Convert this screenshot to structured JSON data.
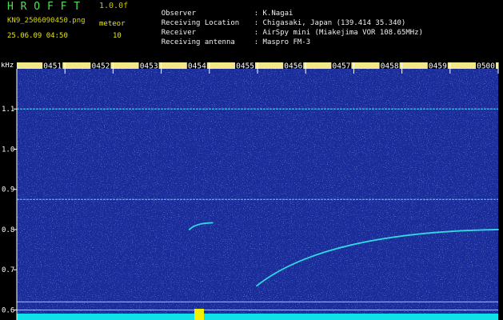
{
  "header": {
    "app_name": "H R O F F T",
    "app_version": "1.0.0f",
    "file_name": "KN9_2506090450.png",
    "mode_label": "meteor",
    "timestamp": "25.06.09 04:50",
    "mode_value": "10",
    "info": [
      {
        "label": "Observer",
        "value": ": K.Nagai"
      },
      {
        "label": "Receiving Location",
        "value": ": Chigasaki, Japan (139.414 35.340)"
      },
      {
        "label": "Receiver",
        "value": ": AirSpy mini (Miakejima VOR 108.65MHz)"
      },
      {
        "label": "Receiving antenna",
        "value": ": Maspro FM-3"
      }
    ]
  },
  "colors": {
    "background": "#000000",
    "noise": "#1a2c9a",
    "signal": "#30d8e0",
    "axis": "#ffffff",
    "time_label_bg": "#f2e88a",
    "app_name": "#4ee24e",
    "label_yellow": "#e8e800"
  },
  "plot": {
    "freq_unit": "kHz",
    "freq_ticks": [
      "1.1",
      "1.0",
      "0.9",
      "0.8",
      "0.7",
      "0.6"
    ],
    "time_labels": [
      "0451",
      "0452",
      "0453",
      "0454",
      "0455",
      "0456",
      "0457",
      "0458",
      "0459",
      "0500"
    ],
    "freq_range_khz": [
      0.575,
      1.2
    ],
    "time_range": [
      "0450",
      "0500"
    ],
    "steady_carriers_khz": [
      1.1,
      0.875,
      0.62,
      0.6
    ],
    "meteor_echoes": [
      {
        "start_time": "0454",
        "end_time": "0454",
        "start_khz": 0.8,
        "end_khz": 0.817
      },
      {
        "start_time": "0455",
        "end_time": "0500",
        "start_khz": 0.66,
        "end_khz": 0.8
      }
    ]
  }
}
